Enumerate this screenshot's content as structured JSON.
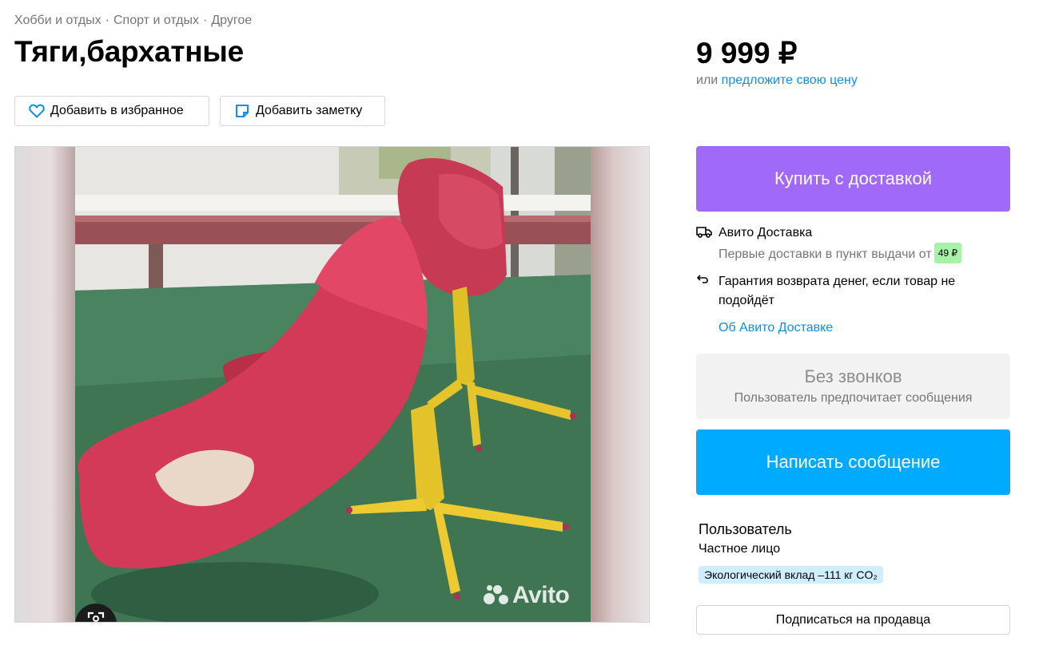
{
  "breadcrumbs": [
    "Хобби и отдых",
    "Спорт и отдых",
    "Другое"
  ],
  "breadcrumb_separator": "·",
  "title": "Тяги,бархатные",
  "actions": {
    "favorite_label": "Добавить в избранное",
    "favorite_icon": "heart-icon",
    "note_label": "Добавить заметку",
    "note_icon": "note-icon"
  },
  "gallery": {
    "watermark": "Avito",
    "zoom_icon": "zoom-icon"
  },
  "price": {
    "value": "9 999 ₽",
    "offer_prefix": "или",
    "offer_link": "предложите свою цену"
  },
  "buy_button": "Купить с доставкой",
  "delivery": {
    "title": "Авито Доставка",
    "title_icon": "truck-icon",
    "first_delivery_text": "Первые доставки в пункт выдачи от",
    "first_delivery_badge": "49 ₽",
    "guarantee_text": "Гарантия возврата денег, если товар не подойдёт",
    "guarantee_icon": "return-arrow-icon",
    "about_link": "Об Авито Доставке"
  },
  "no_calls": {
    "title": "Без звонков",
    "subtitle": "Пользователь предпочитает сообщения"
  },
  "message_button": "Написать сообщение",
  "seller": {
    "name": "Пользователь",
    "type": "Частное лицо",
    "eco_badge": "Экологический вклад –111 кг CO₂",
    "subscribe_button": "Подписаться на продавца"
  },
  "colors": {
    "buy_button": "#a169f7",
    "message_button": "#00aaff",
    "link": "#0a8ff2",
    "badge_green": "#a6f2a6",
    "eco_badge": "#cfeeff"
  }
}
